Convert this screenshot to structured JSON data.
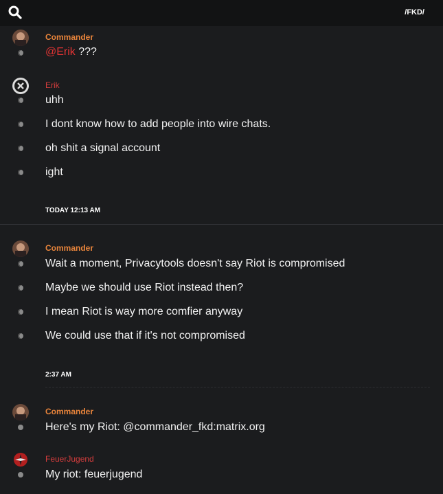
{
  "header": {
    "channel_name": "/FKD/"
  },
  "blocks": {
    "b1": {
      "author": "Commander",
      "mention": "@Erik",
      "text": "???"
    },
    "b2": {
      "author": "Erik",
      "messages": [
        "uhh",
        "I dont know how to add people into wire chats.",
        "oh shit a signal account",
        "ight"
      ]
    },
    "time1": "TODAY 12:13 AM",
    "b3": {
      "author": "Commander",
      "messages": [
        "Wait a moment, Privacytools doesn't say Riot is compromised",
        "Maybe we should use Riot instead then?",
        "I mean Riot is way more comfier anyway",
        "We could use that if it's not compromised"
      ]
    },
    "time2": "2:37 AM",
    "b4": {
      "author": "Commander",
      "messages": [
        "Here's my Riot: @commander_fkd:matrix.org"
      ]
    },
    "b5": {
      "author": "FeuerJugend",
      "messages": [
        "My riot: feuerjugend"
      ]
    }
  },
  "colors": {
    "background": "#1b1c1e",
    "topbar": "#121314",
    "commander_name": "#e8843b",
    "red_name": "#d33d3d",
    "mention": "#e23434"
  },
  "icons": {
    "search": "search-icon",
    "status_dot": "status-dot-icon"
  }
}
